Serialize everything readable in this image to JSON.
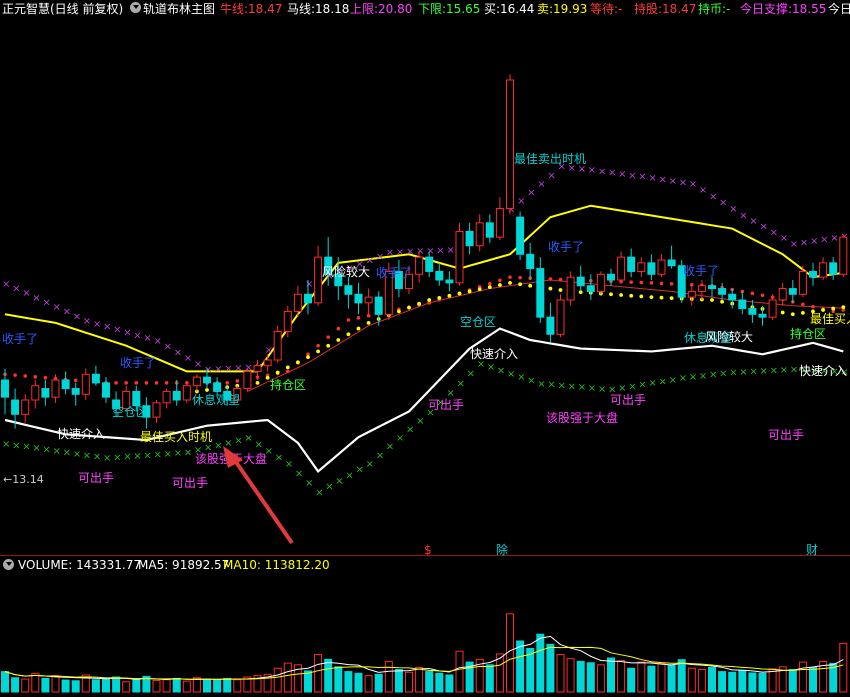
{
  "header": {
    "app_name": "正元智慧",
    "period": "(日线 前复权)",
    "indicator": "轨道布林主图",
    "stats": [
      {
        "label": "牛线:",
        "value": "18.47",
        "label_color": "#ff3a3a",
        "value_color": "#ff3a3a"
      },
      {
        "label": "马线:",
        "value": "18.18",
        "label_color": "#ffffff",
        "value_color": "#ffffff"
      },
      {
        "label": "上限:",
        "value": "20.80",
        "label_color": "#ff40ff",
        "value_color": "#ff40ff"
      },
      {
        "label": "下限:",
        "value": "15.65",
        "label_color": "#33ff33",
        "value_color": "#33ff33"
      },
      {
        "label": "买:",
        "value": "16.44",
        "label_color": "#ffffff",
        "value_color": "#ffffff"
      },
      {
        "label": "卖:",
        "value": "19.93",
        "label_color": "#ffff00",
        "value_color": "#ffff00"
      },
      {
        "label": "等待:",
        "value": "-",
        "label_color": "#ff3a3a",
        "value_color": "#ff3a3a"
      },
      {
        "label": "持股:",
        "value": "18.47",
        "label_color": "#ff3a3a",
        "value_color": "#ff3a3a"
      },
      {
        "label": "持币:",
        "value": "-",
        "label_color": "#33ff33",
        "value_color": "#33ff33"
      },
      {
        "label": "今日支撑:",
        "value": "18.55",
        "label_color": "#ff40ff",
        "value_color": "#ff40ff"
      },
      {
        "label": "今日",
        "value": "",
        "label_color": "#ffffff",
        "value_color": "#ffffff"
      }
    ]
  },
  "volume_header": {
    "volume_label": "VOLUME:",
    "volume_value": "143331.77",
    "ma5_label": "MA5:",
    "ma5_value": "91892.57",
    "ma10_label": "MA10:",
    "ma10_value": "113812.20"
  },
  "event_markers": [
    "$",
    "除",
    "财"
  ],
  "colors": {
    "up_candle": "#ff2a2a",
    "down_candle": "#00d6d6",
    "upper_band": "#ffff00",
    "lower_band": "#ffffff",
    "support_dots": "#ffff00",
    "resist_dots": "#ff3030",
    "magenta_x": "#c040e0",
    "green_x": "#22c022",
    "divider": "#9b1010",
    "arrow": "#e03a3a"
  },
  "chart_data": {
    "type": "candlestick",
    "title": "轨道布林主图",
    "price_label": "13.14",
    "candles": [
      [
        17.05,
        17.25,
        16.45,
        16.75
      ],
      [
        16.7,
        16.9,
        16.2,
        16.45
      ],
      [
        16.45,
        16.8,
        16.3,
        16.7
      ],
      [
        16.7,
        17.05,
        16.55,
        16.95
      ],
      [
        16.9,
        17.05,
        16.6,
        16.75
      ],
      [
        16.75,
        17.15,
        16.65,
        17.05
      ],
      [
        17.05,
        17.2,
        16.8,
        16.9
      ],
      [
        16.9,
        17.0,
        16.6,
        16.8
      ],
      [
        16.8,
        17.25,
        16.7,
        17.15
      ],
      [
        17.15,
        17.3,
        16.95,
        17.0
      ],
      [
        17.0,
        17.1,
        16.65,
        16.75
      ],
      [
        16.7,
        16.85,
        16.4,
        16.55
      ],
      [
        16.55,
        16.95,
        16.5,
        16.85
      ],
      [
        16.85,
        16.95,
        16.5,
        16.6
      ],
      [
        16.6,
        16.75,
        16.2,
        16.4
      ],
      [
        16.4,
        16.7,
        16.3,
        16.65
      ],
      [
        16.65,
        16.9,
        16.55,
        16.85
      ],
      [
        16.85,
        17.05,
        16.6,
        16.7
      ],
      [
        16.7,
        17.0,
        16.65,
        16.95
      ],
      [
        16.95,
        17.15,
        16.85,
        17.1
      ],
      [
        17.1,
        17.25,
        16.9,
        17.0
      ],
      [
        17.0,
        17.1,
        16.75,
        16.85
      ],
      [
        16.85,
        16.95,
        16.6,
        16.7
      ],
      [
        16.7,
        16.95,
        16.65,
        16.9
      ],
      [
        16.9,
        17.25,
        16.85,
        17.2
      ],
      [
        17.2,
        17.4,
        17.05,
        17.3
      ],
      [
        17.3,
        17.5,
        17.2,
        17.4
      ],
      [
        17.4,
        18.0,
        17.35,
        17.9
      ],
      [
        17.9,
        18.35,
        17.8,
        18.25
      ],
      [
        18.25,
        18.7,
        18.15,
        18.55
      ],
      [
        18.55,
        18.8,
        18.2,
        18.4
      ],
      [
        18.4,
        19.4,
        18.35,
        19.2
      ],
      [
        19.2,
        19.55,
        18.7,
        18.9
      ],
      [
        18.9,
        19.2,
        18.45,
        18.7
      ],
      [
        18.7,
        18.85,
        18.3,
        18.55
      ],
      [
        18.55,
        18.75,
        18.2,
        18.4
      ],
      [
        18.4,
        18.65,
        18.15,
        18.5
      ],
      [
        18.5,
        18.6,
        18.0,
        18.2
      ],
      [
        18.2,
        19.1,
        18.1,
        18.95
      ],
      [
        18.95,
        19.15,
        18.5,
        18.65
      ],
      [
        18.65,
        19.05,
        18.55,
        18.9
      ],
      [
        18.9,
        19.3,
        18.75,
        19.2
      ],
      [
        19.2,
        19.3,
        18.85,
        18.95
      ],
      [
        18.95,
        19.1,
        18.7,
        18.8
      ],
      [
        18.8,
        18.95,
        18.6,
        18.75
      ],
      [
        18.75,
        19.8,
        18.7,
        19.65
      ],
      [
        19.65,
        19.8,
        19.25,
        19.4
      ],
      [
        19.4,
        19.95,
        19.3,
        19.8
      ],
      [
        19.8,
        19.95,
        19.45,
        19.55
      ],
      [
        19.55,
        20.25,
        19.5,
        20.05
      ],
      [
        20.05,
        22.4,
        19.95,
        22.3
      ],
      [
        19.9,
        20.0,
        19.15,
        19.25
      ],
      [
        19.25,
        19.45,
        18.8,
        19.0
      ],
      [
        19.0,
        19.2,
        18.05,
        18.15
      ],
      [
        18.15,
        18.4,
        17.7,
        17.85
      ],
      [
        17.85,
        18.55,
        17.8,
        18.45
      ],
      [
        18.45,
        18.95,
        18.35,
        18.85
      ],
      [
        18.85,
        19.05,
        18.6,
        18.7
      ],
      [
        18.7,
        18.9,
        18.45,
        18.6
      ],
      [
        18.6,
        18.95,
        18.55,
        18.9
      ],
      [
        18.9,
        19.0,
        18.7,
        18.8
      ],
      [
        18.8,
        19.3,
        18.75,
        19.2
      ],
      [
        19.2,
        19.35,
        18.85,
        18.95
      ],
      [
        18.95,
        19.2,
        18.85,
        19.1
      ],
      [
        19.1,
        19.25,
        18.8,
        18.9
      ],
      [
        18.9,
        19.25,
        18.85,
        19.15
      ],
      [
        19.15,
        19.4,
        19.0,
        19.05
      ],
      [
        19.05,
        19.15,
        18.4,
        18.5
      ],
      [
        18.5,
        18.7,
        18.35,
        18.6
      ],
      [
        18.6,
        18.8,
        18.45,
        18.7
      ],
      [
        18.7,
        18.85,
        18.5,
        18.65
      ],
      [
        18.65,
        18.75,
        18.45,
        18.55
      ],
      [
        18.55,
        18.65,
        18.3,
        18.45
      ],
      [
        18.45,
        18.6,
        18.2,
        18.3
      ],
      [
        18.3,
        18.45,
        18.05,
        18.2
      ],
      [
        18.2,
        18.35,
        18.0,
        18.15
      ],
      [
        18.15,
        18.55,
        18.1,
        18.45
      ],
      [
        18.45,
        18.75,
        18.35,
        18.65
      ],
      [
        18.65,
        18.8,
        18.4,
        18.55
      ],
      [
        18.55,
        19.05,
        18.5,
        18.95
      ],
      [
        18.95,
        19.1,
        18.7,
        18.85
      ],
      [
        18.85,
        19.2,
        18.8,
        19.1
      ],
      [
        19.1,
        19.2,
        18.8,
        18.9
      ],
      [
        18.9,
        19.6,
        18.85,
        19.55
      ]
    ],
    "volume": [
      60,
      42,
      38,
      55,
      40,
      48,
      35,
      33,
      50,
      36,
      40,
      44,
      30,
      38,
      46,
      34,
      36,
      40,
      32,
      42,
      38,
      35,
      40,
      36,
      44,
      48,
      52,
      70,
      85,
      80,
      62,
      110,
      96,
      74,
      60,
      55,
      48,
      52,
      90,
      66,
      58,
      72,
      60,
      55,
      50,
      120,
      88,
      96,
      80,
      112,
      230,
      150,
      128,
      170,
      140,
      110,
      98,
      90,
      86,
      80,
      100,
      92,
      70,
      88,
      76,
      84,
      80,
      95,
      70,
      66,
      72,
      60,
      58,
      64,
      56,
      55,
      68,
      74,
      66,
      88,
      72,
      90,
      84,
      143
    ],
    "annotations": [
      {
        "text": "快速介入",
        "color": "#ffffff"
      },
      {
        "text": "空仓区",
        "color": "#00d0d0"
      },
      {
        "text": "最佳买入时机",
        "color": "#ffff00"
      },
      {
        "text": "该股强于大盘",
        "color": "#ff40ff"
      },
      {
        "text": "可出手",
        "color": "#ff40ff"
      },
      {
        "text": "可出手",
        "color": "#ff40ff"
      },
      {
        "text": "休息观望",
        "color": "#00d0d0"
      },
      {
        "text": "持仓区",
        "color": "#33ff33"
      },
      {
        "text": "风险较大",
        "color": "#ffffff"
      },
      {
        "text": "收手了",
        "color": "#2a5aff"
      },
      {
        "text": "收手了",
        "color": "#2a5aff"
      },
      {
        "text": "收手了",
        "color": "#2a5aff"
      },
      {
        "text": "空仓区",
        "color": "#00d0d0"
      },
      {
        "text": "快速介入",
        "color": "#ffffff"
      },
      {
        "text": "可出手",
        "color": "#ff40ff"
      },
      {
        "text": "最佳卖出时机",
        "color": "#00d0d0"
      },
      {
        "text": "收手了",
        "color": "#2a5aff"
      },
      {
        "text": "该股强于大盘",
        "color": "#ff40ff"
      },
      {
        "text": "可出手",
        "color": "#ff40ff"
      },
      {
        "text": "收手了",
        "color": "#2a5aff"
      },
      {
        "text": "休息观望",
        "color": "#00d0d0"
      },
      {
        "text": "风险较大",
        "color": "#ffffff"
      },
      {
        "text": "可出手",
        "color": "#ff40ff"
      },
      {
        "text": "快速介入",
        "color": "#ffffff"
      },
      {
        "text": "持仓区",
        "color": "#33ff33"
      },
      {
        "text": "最佳买入",
        "color": "#ffff00"
      }
    ]
  }
}
